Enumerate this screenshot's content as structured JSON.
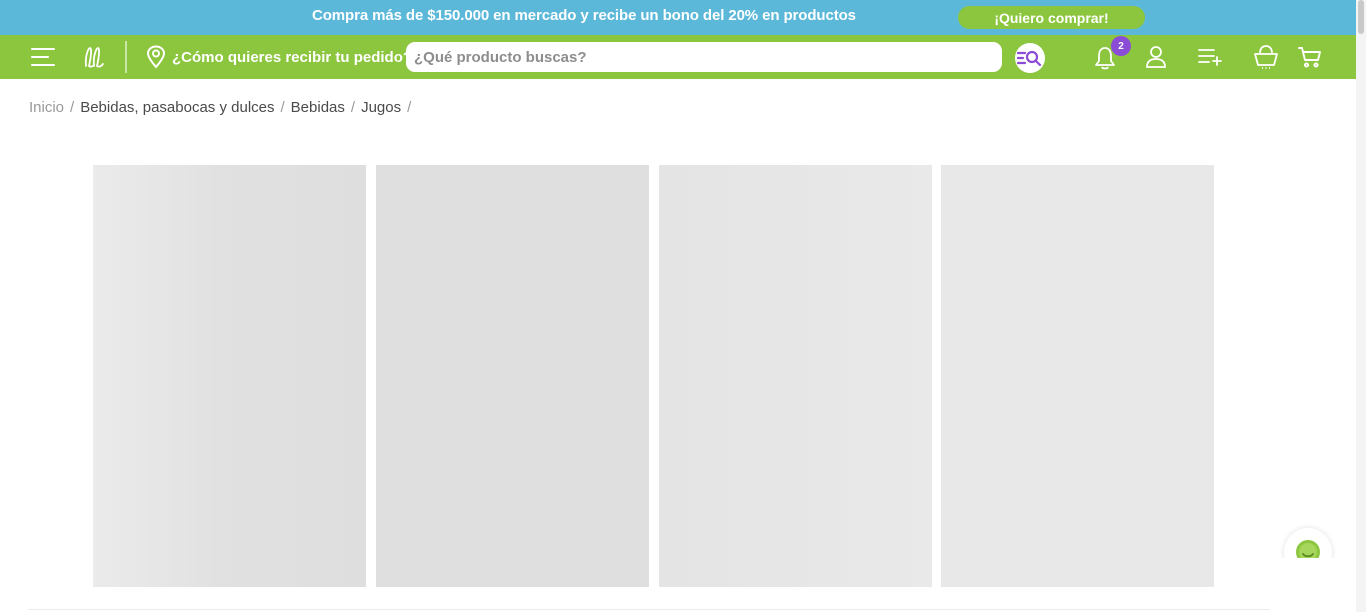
{
  "promo": {
    "text": "Compra más de $150.000 en mercado y recibe un bono del 20% en productos",
    "cta_label": "¡Quiero comprar!"
  },
  "header": {
    "delivery_label": "¿Cómo quieres recibir tu pedido?",
    "search_placeholder": "¿Qué producto buscas?",
    "notification_count": "2"
  },
  "breadcrumb": {
    "items": [
      "Inicio",
      "Bebidas, pasabocas y dulces",
      "Bebidas",
      "Jugos"
    ],
    "separator": "/"
  },
  "colors": {
    "promo_bg": "#5bb8d9",
    "header_bg": "#8cc63e",
    "accent_purple": "#8b4dd6",
    "skeleton": "#e2e2e2"
  },
  "icons": [
    "menu-icon",
    "brand-logo-icon",
    "location-pin-icon",
    "search-filter-icon",
    "bell-icon",
    "user-icon",
    "shopping-list-icon",
    "basket-icon",
    "cart-icon",
    "chat-icon"
  ]
}
